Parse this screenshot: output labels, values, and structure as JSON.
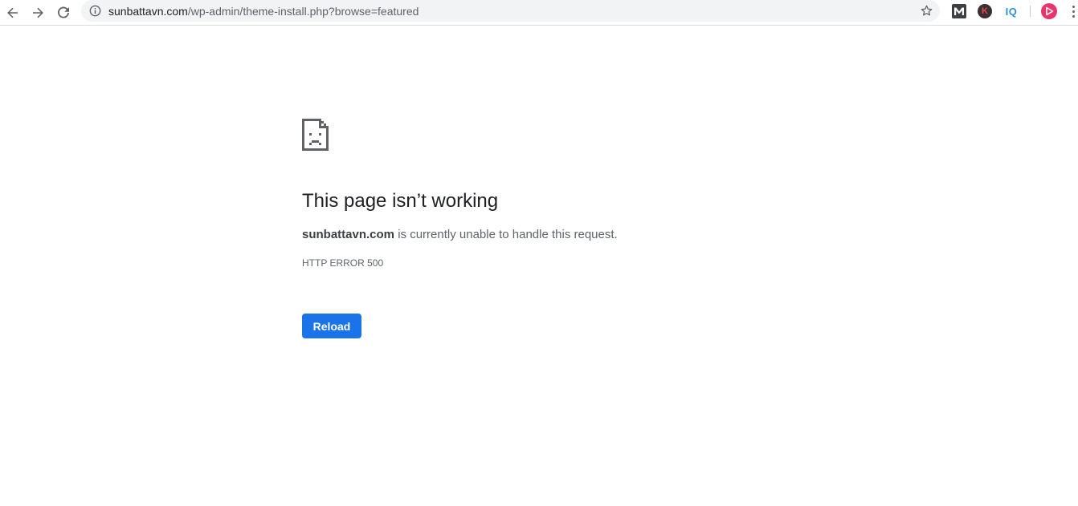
{
  "browser": {
    "url_host": "sunbattavn.com",
    "url_path": "/wp-admin/theme-install.php?browse=featured",
    "extensions": {
      "k_label": "K",
      "iq_label": "IQ"
    }
  },
  "error_page": {
    "title": "This page isn’t working",
    "site": "sunbattavn.com",
    "message": " is currently unable to handle this request.",
    "error_code": "HTTP ERROR 500",
    "reload_label": "Reload"
  },
  "colors": {
    "accent": "#1a73e8",
    "text_primary": "#202124",
    "text_secondary": "#5f6368",
    "omnibox_bg": "#f1f3f4"
  }
}
